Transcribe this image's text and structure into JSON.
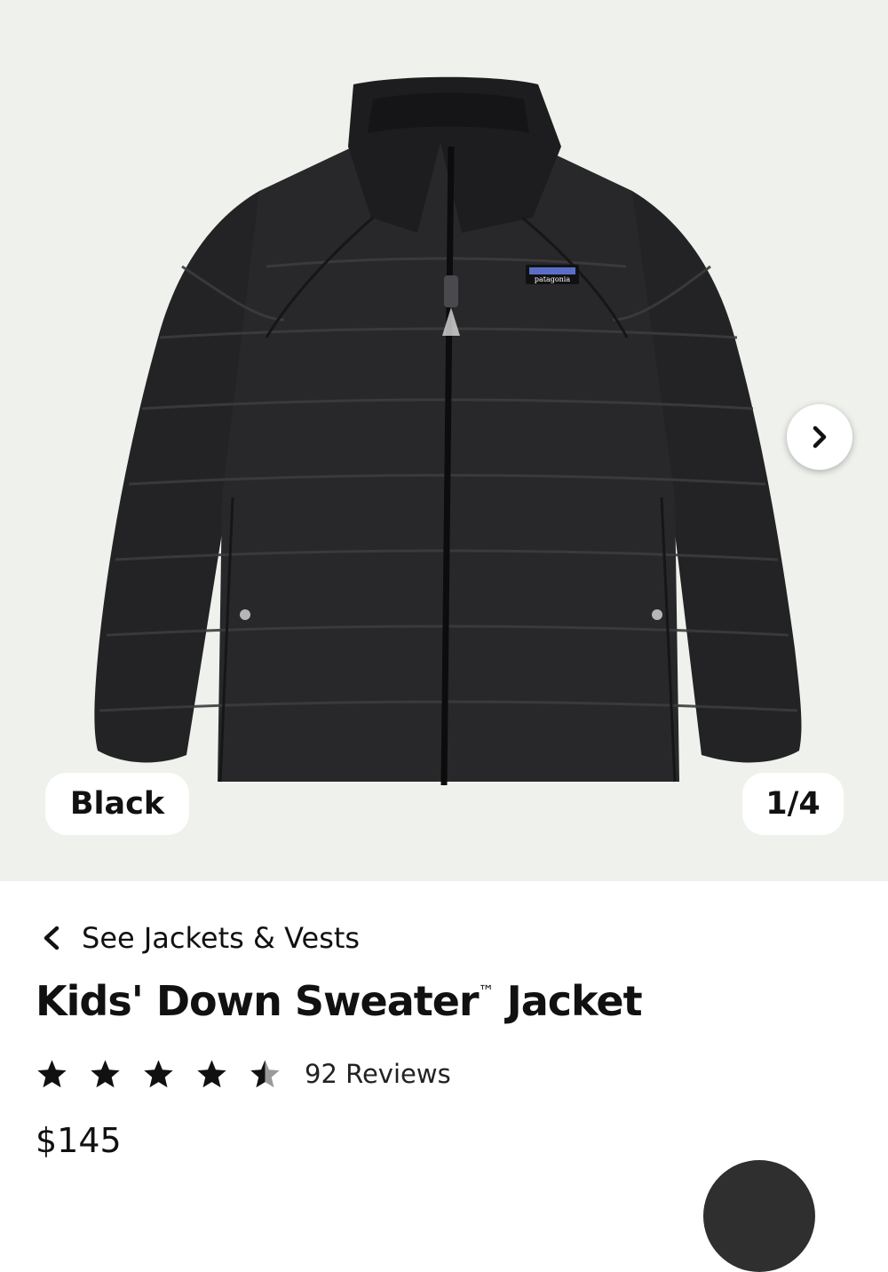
{
  "product_image": {
    "color_label": "Black",
    "counter": "1/4",
    "brand_patch_text": "patagonia"
  },
  "breadcrumb": {
    "label": "See Jackets & Vests"
  },
  "product": {
    "name": "Kids' Down Sweater",
    "trademark": "™",
    "name_suffix": " Jacket",
    "rating": 4.5,
    "reviews": "92 Reviews",
    "price": "$145"
  },
  "icons": {
    "next": "chevron-right-icon",
    "back": "chevron-left-icon",
    "star": "star-icon"
  },
  "colors": {
    "hero_bg": "#eff1ec",
    "jacket": "#252527",
    "star_filled": "#111111",
    "star_empty": "#9a9a9a"
  }
}
